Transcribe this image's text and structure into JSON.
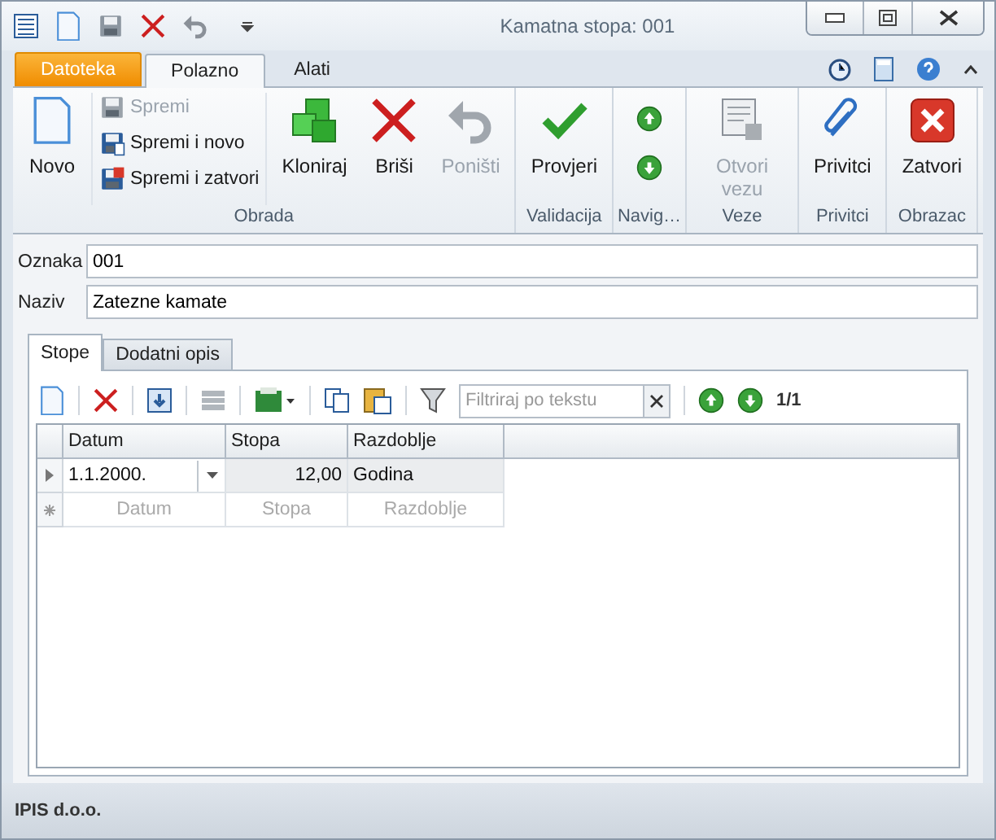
{
  "window": {
    "title": "Kamatna stopa: 001"
  },
  "ribbon_tabs": [
    {
      "label": "Datoteka",
      "kind": "file",
      "selected": false
    },
    {
      "label": "Polazno",
      "kind": "tab",
      "selected": true
    },
    {
      "label": "Alati",
      "kind": "tab",
      "selected": false
    }
  ],
  "ribbon_groups": [
    {
      "label": "Obrada",
      "items": [
        {
          "kind": "large",
          "label": "Novo",
          "disabled": false
        },
        {
          "kind": "stack",
          "buttons": [
            {
              "label": "Spremi",
              "disabled": true
            },
            {
              "label": "Spremi i novo",
              "disabled": false
            },
            {
              "label": "Spremi i zatvori",
              "disabled": false
            }
          ]
        },
        {
          "kind": "large",
          "label": "Kloniraj",
          "disabled": false
        },
        {
          "kind": "large",
          "label": "Briši",
          "disabled": false
        },
        {
          "kind": "large",
          "label": "Poništi",
          "disabled": true
        }
      ]
    },
    {
      "label": "Validacija",
      "items": [
        {
          "kind": "large",
          "label": "Provjeri",
          "disabled": false
        }
      ]
    },
    {
      "label": "Navig…",
      "items": [
        {
          "kind": "arrows"
        }
      ]
    },
    {
      "label": "Veze",
      "items": [
        {
          "kind": "large",
          "label": "Otvori vezu",
          "disabled": true
        }
      ]
    },
    {
      "label": "Privitci",
      "items": [
        {
          "kind": "large",
          "label": "Privitci",
          "disabled": false
        }
      ]
    },
    {
      "label": "Obrazac",
      "items": [
        {
          "kind": "large",
          "label": "Zatvori",
          "disabled": false
        }
      ]
    }
  ],
  "fields": [
    {
      "label": "Oznaka",
      "value": "001"
    },
    {
      "label": "Naziv",
      "value": "Zatezne kamate"
    }
  ],
  "tabs": [
    {
      "label": "Stope",
      "selected": true
    },
    {
      "label": "Dodatni opis",
      "selected": false
    }
  ],
  "filter": {
    "placeholder": "Filtriraj po tekstu"
  },
  "pager": "1/1",
  "grid": {
    "columns": [
      "Datum",
      "Stopa",
      "Razdoblje"
    ],
    "rows": [
      {
        "cells": [
          "1.1.2000.",
          "12,00",
          "Godina"
        ],
        "selected": true
      }
    ],
    "new_row": [
      "Datum",
      "Stopa",
      "Razdoblje"
    ]
  },
  "status_bar": "IPIS d.o.o."
}
